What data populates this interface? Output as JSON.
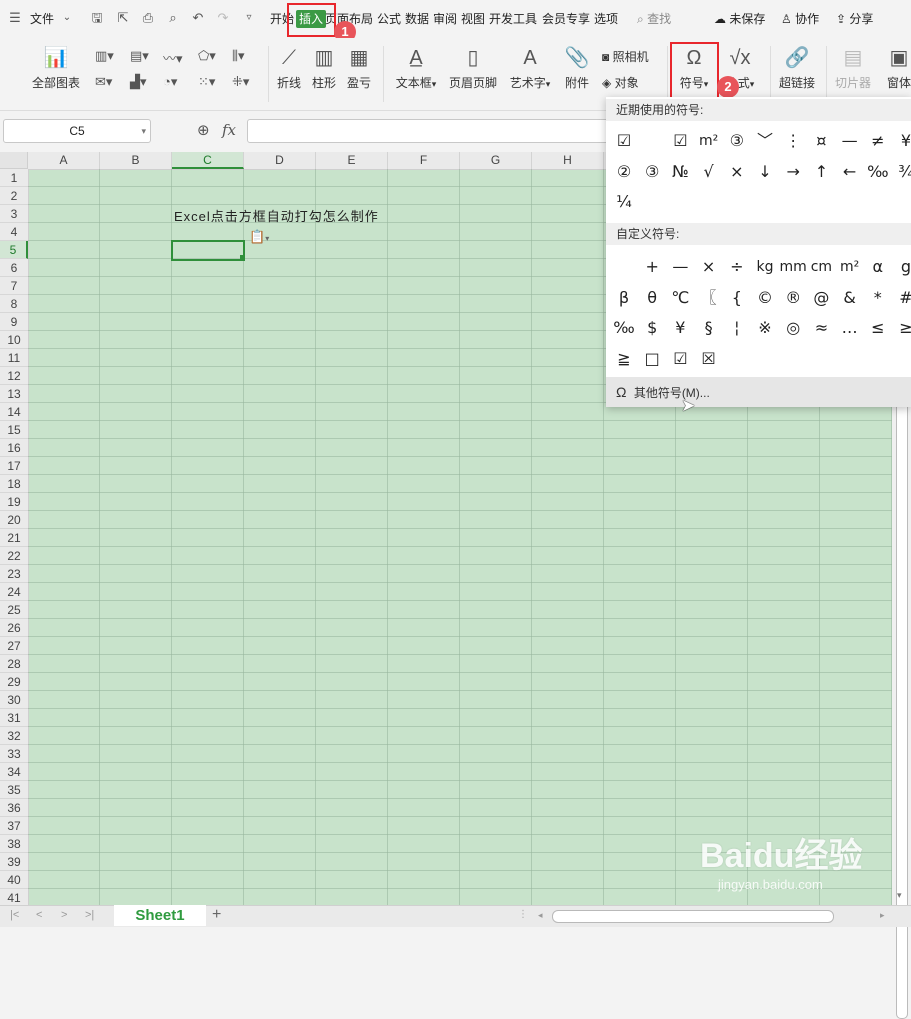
{
  "menubar": {
    "file": "文件",
    "tabs": [
      "开始",
      "插入",
      "页面布局",
      "公式",
      "数据",
      "审阅",
      "视图",
      "开发工具",
      "会员专享",
      "选项"
    ],
    "search": "查找",
    "unsaved": "未保存",
    "collab": "协作",
    "share": "分享"
  },
  "ribbon": {
    "all_charts": "全部图表",
    "sparkline_line": "折线",
    "sparkline_bar": "柱形",
    "sparkline_winloss": "盈亏",
    "textbox": "文本框",
    "header_footer": "页眉页脚",
    "wordart": "艺术字",
    "attachment": "附件",
    "camera": "照相机",
    "object": "对象",
    "symbol": "符号",
    "formula": "公式",
    "hyperlink": "超链接",
    "slicer": "切片器",
    "window": "窗体"
  },
  "badges": {
    "step1": "1",
    "step2": "2"
  },
  "formula_bar": {
    "name_box": "C5",
    "fx": "fx",
    "value": ""
  },
  "sheet": {
    "columns": [
      "A",
      "B",
      "C",
      "D",
      "E",
      "F",
      "G",
      "H"
    ],
    "rows": [
      "1",
      "2",
      "3",
      "4",
      "5",
      "6",
      "7",
      "8",
      "9",
      "10",
      "11",
      "12",
      "13",
      "14",
      "15",
      "16",
      "17",
      "18",
      "19",
      "20",
      "21",
      "22",
      "23",
      "24",
      "25",
      "26",
      "27",
      "28",
      "29",
      "30",
      "31",
      "32",
      "33",
      "34",
      "35",
      "36",
      "37",
      "38",
      "39",
      "40",
      "41"
    ],
    "c3_text": "Excel点击方框自动打勾怎么制作",
    "active_cell": "C5",
    "tab_name": "Sheet1"
  },
  "symbol_popup": {
    "recent_title": "近期使用的符号:",
    "recent": [
      "☑",
      "",
      "☑",
      "m²",
      "③",
      "﹀",
      "⋮",
      "¤",
      "—",
      "≠",
      "¥",
      "②",
      "③",
      "№",
      "√",
      "×",
      "↓",
      "→",
      "↑",
      "←",
      "‰",
      "¾",
      "¼"
    ],
    "custom_title": "自定义符号:",
    "custom": [
      "",
      "+",
      "—",
      "×",
      "÷",
      "kg",
      "mm",
      "cm",
      "m²",
      "α",
      "g",
      "β",
      "θ",
      "℃",
      "〖",
      "{",
      "©",
      "®",
      "@",
      "&",
      "*",
      "#",
      "‰",
      "$",
      "¥",
      "§",
      "¦",
      "※",
      "◎",
      "≈",
      "…",
      "≤",
      "≥",
      "≧",
      "□",
      "☑",
      "☒"
    ],
    "more": "其他符号(M)..."
  },
  "watermark": {
    "brand": "Baidu经验",
    "url": "jingyan.baidu.com"
  },
  "colors": {
    "accent": "#3c9a45",
    "highlight": "#e8262c",
    "grid_bg": "#c8e3cb"
  }
}
